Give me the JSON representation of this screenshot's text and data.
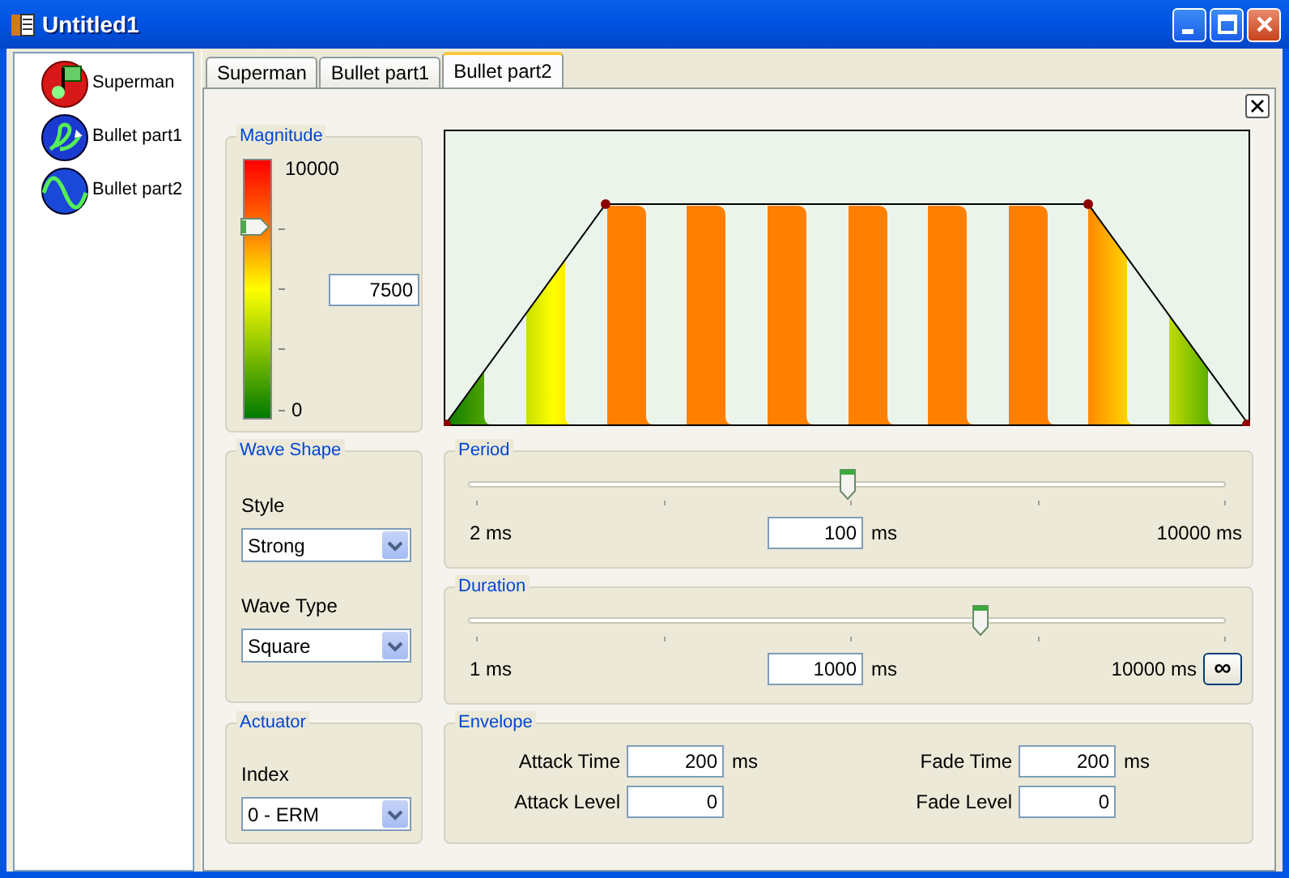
{
  "window": {
    "title": "Untitled1"
  },
  "sidebar": {
    "items": [
      {
        "label": "Superman",
        "kind": "music"
      },
      {
        "label": "Bullet part1",
        "kind": "loop"
      },
      {
        "label": "Bullet part2",
        "kind": "wave"
      }
    ]
  },
  "tabs": [
    {
      "label": "Superman",
      "selected": false
    },
    {
      "label": "Bullet part1",
      "selected": false
    },
    {
      "label": "Bullet part2",
      "selected": true
    }
  ],
  "magnitude": {
    "title": "Magnitude",
    "max_label": "10000",
    "min_label": "0",
    "level": 0.75,
    "value": "7500"
  },
  "wave_shape": {
    "title": "Wave Shape",
    "style_label": "Style",
    "style_value": "Strong",
    "type_label": "Wave Type",
    "type_value": "Square"
  },
  "period": {
    "title": "Period",
    "level": 0.5,
    "min_label": "2 ms",
    "value": "100",
    "unit": "ms",
    "max_label": "10000 ms"
  },
  "duration": {
    "title": "Duration",
    "level": 0.677,
    "min_label": "1 ms",
    "value": "1000",
    "unit": "ms",
    "max_label": "10000 ms",
    "infinite_button": "∞"
  },
  "actuator": {
    "title": "Actuator",
    "index_label": "Index",
    "index_value": "0 - ERM"
  },
  "envelope": {
    "title": "Envelope",
    "fields": [
      {
        "label": "Attack Time",
        "value": "200",
        "unit": "ms"
      },
      {
        "label": "Fade Time",
        "value": "200",
        "unit": "ms"
      },
      {
        "label": "Attack Level",
        "value": "0"
      },
      {
        "label": "Fade Level",
        "value": "0"
      }
    ]
  }
}
